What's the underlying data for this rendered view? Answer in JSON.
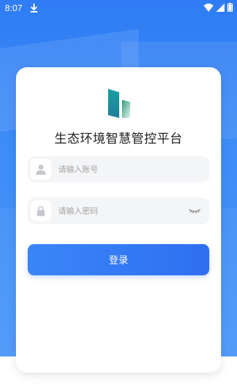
{
  "status_bar": {
    "time": "8:07",
    "icons": [
      "download-icon",
      "wifi-icon",
      "signal-icon",
      "battery-icon"
    ]
  },
  "app": {
    "title": "生态环境智慧管控平台",
    "logo": "app-logo"
  },
  "form": {
    "username_placeholder": "请输入账号",
    "username_value": "",
    "password_placeholder": "请输入密码",
    "password_value": "",
    "user_icon": "user-icon",
    "lock_icon": "lock-icon",
    "eye_icon": "eye-closed-icon",
    "login_label": "登录"
  },
  "colors": {
    "primary": "#2f7cf4",
    "button_start": "#3a86f8",
    "button_end": "#2f6ff0",
    "field_bg": "#f4f5f7",
    "logo_green": "#3aa68a",
    "logo_teal": "#1f8fa8"
  }
}
